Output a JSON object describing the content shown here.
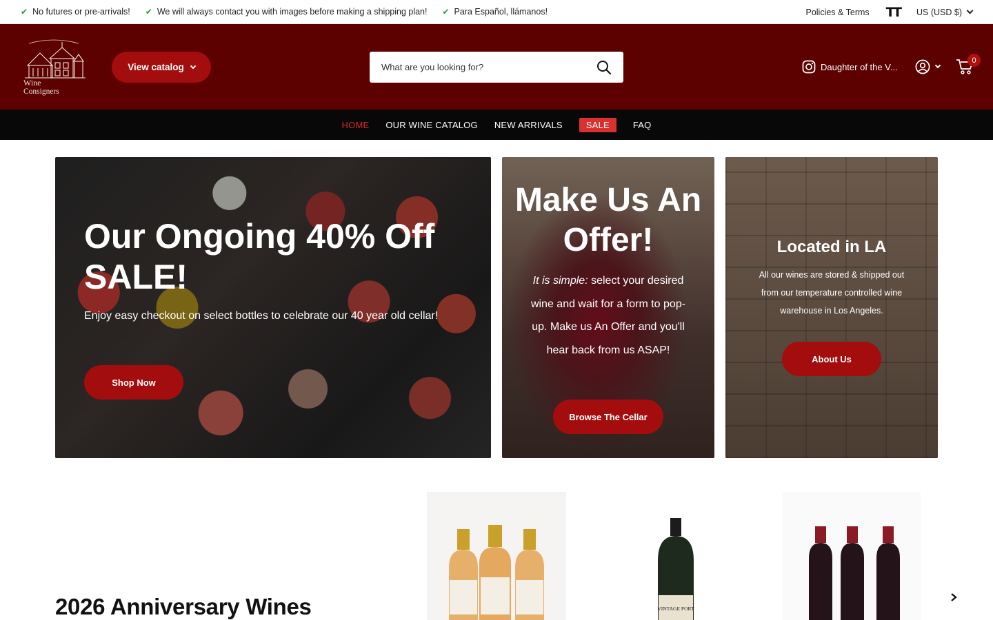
{
  "announcements": [
    {
      "text": "No futures or pre-arrivals!"
    },
    {
      "text": "We will always contact you with images before making a shipping plan!"
    },
    {
      "text": "Para Español, llámanos!"
    }
  ],
  "topbar": {
    "policies_label": "Policies & Terms",
    "text_size_icon": "text-size-icon",
    "currency_label": "US (USD $)"
  },
  "header": {
    "logo_text_line1": "Wine",
    "logo_text_line2": "Consigners",
    "view_catalog_label": "View catalog",
    "search_placeholder": "What are you looking for?",
    "instagram_label": "Daughter of the V...",
    "cart_count": "0"
  },
  "nav": {
    "items": [
      {
        "label": "HOME"
      },
      {
        "label": "OUR WINE CATALOG"
      },
      {
        "label": "NEW ARRIVALS"
      },
      {
        "label": "SALE"
      },
      {
        "label": "FAQ"
      }
    ]
  },
  "hero": {
    "sale": {
      "title": "Our Ongoing 40% Off SALE!",
      "text": "Enjoy easy checkout on select bottles to celebrate our 40 year old cellar!",
      "button": "Shop Now"
    },
    "offer": {
      "title": "Make Us An Offer!",
      "text_em": "It is simple:",
      "text_rest": " select your desired wine and wait for a form to pop-up. Make us An Offer and you'll hear back from us ASAP!",
      "button": "Browse The Cellar"
    },
    "location": {
      "title": "Located in LA",
      "text": "All our wines are stored & shipped out from our temperature controlled wine warehouse in Los Angeles.",
      "button": "About Us"
    }
  },
  "anniversary": {
    "title": "2026 Anniversary Wines",
    "product_labels": [
      "VINTAGE PORT"
    ]
  },
  "colors": {
    "header_bg": "#5c0000",
    "accent_red": "#a30d0d",
    "nav_bg": "#080808",
    "nav_active": "#e02424",
    "sale_badge": "#d93030"
  }
}
